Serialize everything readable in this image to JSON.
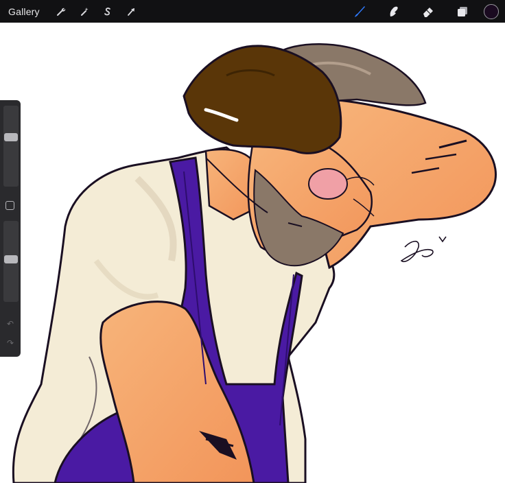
{
  "topbar": {
    "gallery_label": "Gallery",
    "left_tools": [
      {
        "name": "actions",
        "icon": "wrench-icon"
      },
      {
        "name": "adjustments",
        "icon": "magic-wand-icon"
      },
      {
        "name": "selection",
        "icon": "selection-s-icon"
      },
      {
        "name": "transform",
        "icon": "arrow-cursor-icon"
      }
    ],
    "right_tools": [
      {
        "name": "brush",
        "icon": "brush-icon",
        "active": true
      },
      {
        "name": "smudge",
        "icon": "smudge-icon"
      },
      {
        "name": "eraser",
        "icon": "eraser-icon"
      },
      {
        "name": "layers",
        "icon": "layers-icon"
      }
    ],
    "current_color": "#1a0a20"
  },
  "sidebar": {
    "brush_size_level": 0.62,
    "opacity_level": 0.53
  },
  "colors": {
    "toolbar_bg": "#111113",
    "active_tool": "#2f7bff",
    "canvas_bg": "#ffffff",
    "overalls": "#4a1aa3",
    "skin": "#f4a262",
    "shirt": "#f4ecd6",
    "glove": "#5a3608",
    "hair_beard": "#8a7868",
    "lens_pink": "#f0a0a6",
    "ink": "#1a0f22"
  }
}
